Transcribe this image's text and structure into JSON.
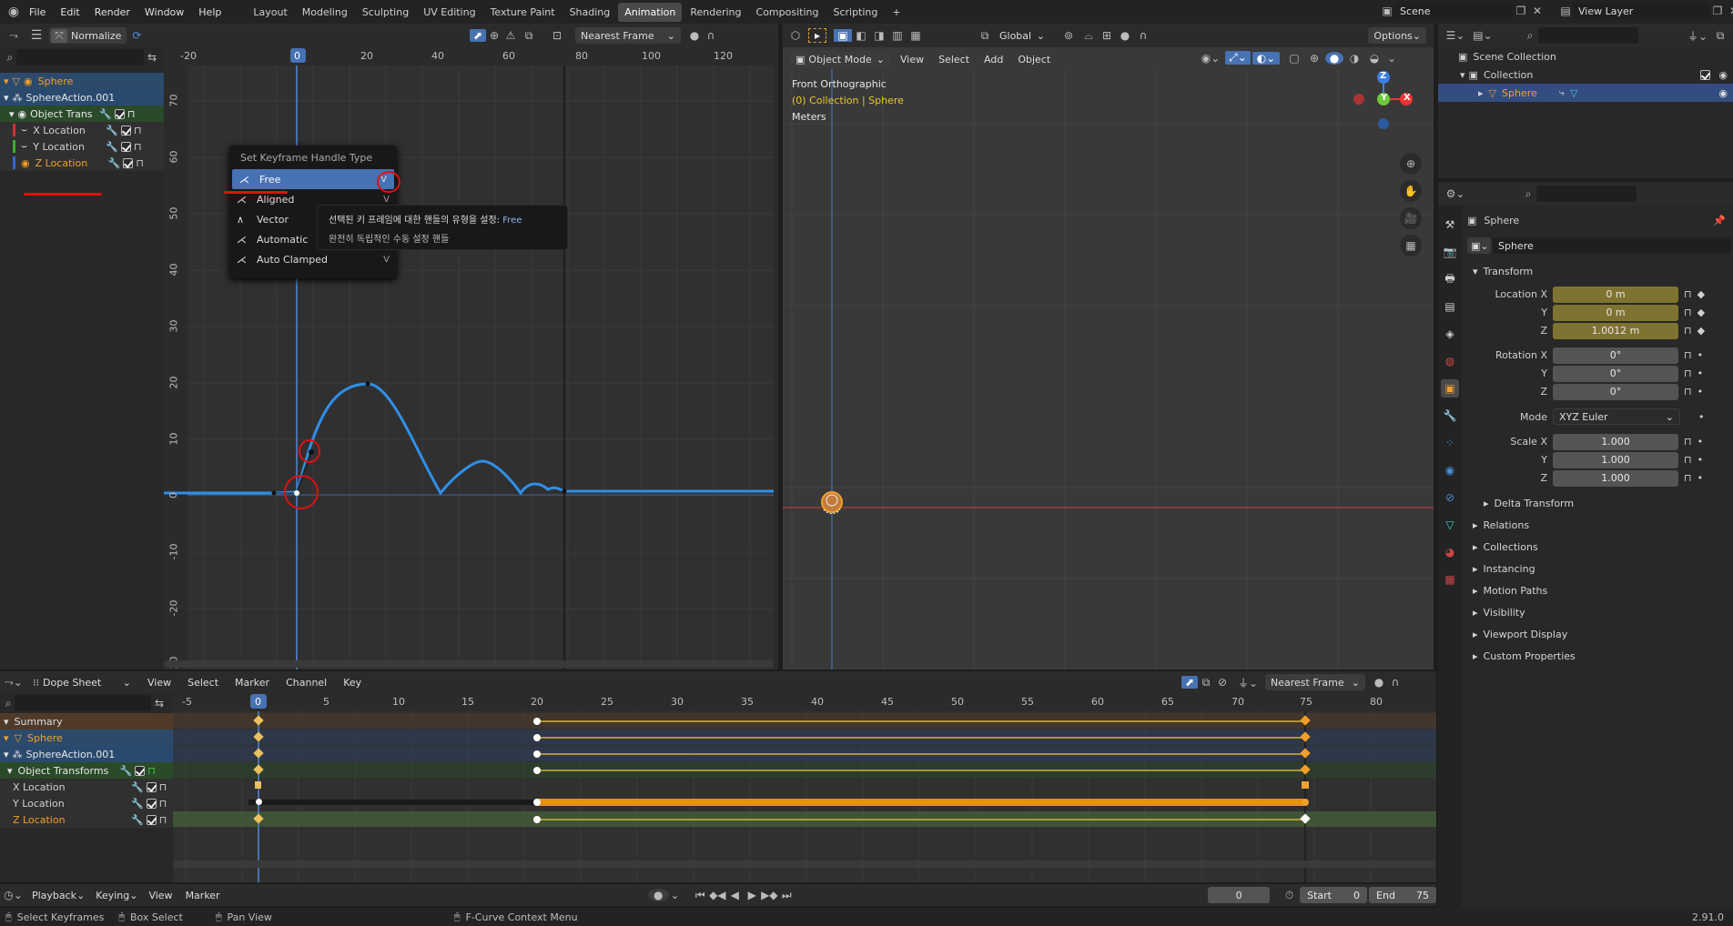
{
  "topbar": {
    "menus": [
      "File",
      "Edit",
      "Render",
      "Window",
      "Help"
    ],
    "workspaces": [
      "Layout",
      "Modeling",
      "Sculpting",
      "UV Editing",
      "Texture Paint",
      "Shading",
      "Animation",
      "Rendering",
      "Compositing",
      "Scripting"
    ],
    "active_workspace": "Animation",
    "add_tab": "+",
    "scene": "Scene",
    "view_layer": "View Layer"
  },
  "graph_editor": {
    "normalize_label": "Normalize",
    "snap_mode": "Nearest Frame",
    "x_ticks": [
      "-20",
      "0",
      "20",
      "40",
      "60",
      "80",
      "100",
      "120"
    ],
    "current_frame": "0",
    "y_ticks": [
      "70",
      "60",
      "50",
      "40",
      "30",
      "20",
      "10",
      "0",
      "-10",
      "-20",
      "-30"
    ],
    "channels": [
      {
        "label": "Sphere",
        "kind": "object"
      },
      {
        "label": "SphereAction.001",
        "kind": "action"
      },
      {
        "label": "Object Trans",
        "kind": "group"
      },
      {
        "label": "X Location",
        "kind": "fcurve"
      },
      {
        "label": "Y Location",
        "kind": "fcurve"
      },
      {
        "label": "Z Location",
        "kind": "fcurve-active"
      }
    ],
    "context_menu": {
      "title": "Set Keyframe Handle Type",
      "items": [
        {
          "label": "Free",
          "key": "V"
        },
        {
          "label": "Aligned",
          "key": "V"
        },
        {
          "label": "Vector",
          "key": "V"
        },
        {
          "label": "Automatic",
          "key": "V"
        },
        {
          "label": "Auto Clamped",
          "key": "V"
        }
      ],
      "tooltip_line1": "선택된 키 프레임에 대한 핸들의 유형을 설정:",
      "tooltip_value": "Free",
      "tooltip_line2": "완전히 독립적인 수동 설정 핸들"
    }
  },
  "viewport": {
    "mode": "Object Mode",
    "menus": [
      "View",
      "Select",
      "Add",
      "Object"
    ],
    "orientation": "Global",
    "options": "Options",
    "overlay_title": "Front Orthographic",
    "overlay_collection": "(0) Collection | Sphere",
    "overlay_units": "Meters",
    "axes": {
      "z": "Z",
      "y": "Y",
      "x": "X"
    }
  },
  "outliner": {
    "items": [
      {
        "label": "Scene Collection",
        "level": 0
      },
      {
        "label": "Collection",
        "level": 1
      },
      {
        "label": "Sphere",
        "level": 2,
        "selected": true
      }
    ]
  },
  "properties": {
    "object_name": "Sphere",
    "datablock_name": "Sphere",
    "transform_header": "Transform",
    "location": [
      {
        "label": "Location X",
        "value": "0 m"
      },
      {
        "label": "Y",
        "value": "0 m"
      },
      {
        "label": "Z",
        "value": "1.0012 m"
      }
    ],
    "rotation": [
      {
        "label": "Rotation X",
        "value": "0°"
      },
      {
        "label": "Y",
        "value": "0°"
      },
      {
        "label": "Z",
        "value": "0°"
      }
    ],
    "mode_label": "Mode",
    "mode_value": "XYZ Euler",
    "scale": [
      {
        "label": "Scale X",
        "value": "1.000"
      },
      {
        "label": "Y",
        "value": "1.000"
      },
      {
        "label": "Z",
        "value": "1.000"
      }
    ],
    "delta_transform": "Delta Transform",
    "sections": [
      "Relations",
      "Collections",
      "Instancing",
      "Motion Paths",
      "Visibility",
      "Viewport Display",
      "Custom Properties"
    ]
  },
  "dopesheet": {
    "editor": "Dope Sheet",
    "menus": [
      "View",
      "Select",
      "Marker",
      "Channel",
      "Key"
    ],
    "snap_mode": "Nearest Frame",
    "x_ticks": [
      "-5",
      "0",
      "5",
      "10",
      "15",
      "20",
      "25",
      "30",
      "35",
      "40",
      "45",
      "50",
      "55",
      "60",
      "65",
      "70",
      "75",
      "80"
    ],
    "current_frame": "0",
    "channels": [
      {
        "label": "Summary",
        "kind": "summary"
      },
      {
        "label": "Sphere",
        "kind": "object"
      },
      {
        "label": "SphereAction.001",
        "kind": "action"
      },
      {
        "label": "Object Transforms",
        "kind": "group"
      },
      {
        "label": "X Location",
        "kind": "fcurve"
      },
      {
        "label": "Y Location",
        "kind": "fcurve"
      },
      {
        "label": "Z Location",
        "kind": "fcurve-active"
      }
    ]
  },
  "timeline": {
    "menus": [
      "Playback",
      "Keying",
      "View",
      "Marker"
    ],
    "current_frame": "0",
    "start_label": "Start",
    "start_value": "0",
    "end_label": "End",
    "end_value": "75"
  },
  "statusbar": {
    "items": [
      "Select Keyframes",
      "Box Select",
      "Pan View",
      "F-Curve Context Menu"
    ],
    "version": "2.91.0"
  },
  "colors": {
    "accent_blue": "#4772b3",
    "curve_blue": "#2f8fe8",
    "keyframe_orange": "#f0a02a",
    "annotation_red": "#e01010",
    "animated_field": "#7f7331"
  }
}
